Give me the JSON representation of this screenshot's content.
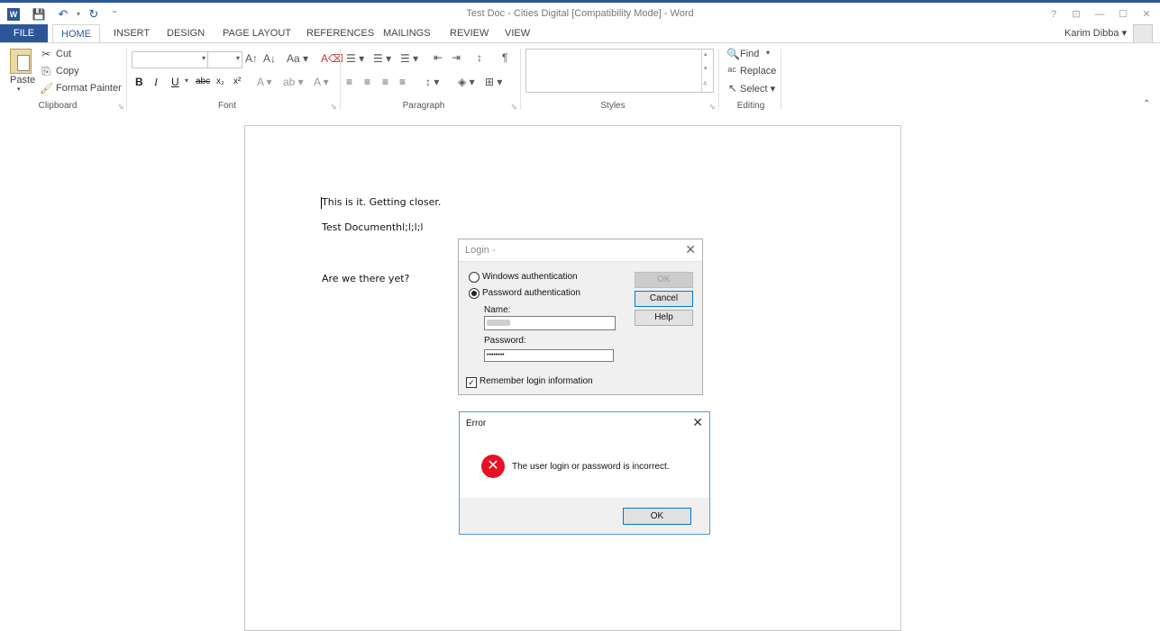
{
  "window": {
    "title": "Test Doc - Cities Digital [Compatibility Mode] - Word",
    "quick_access": {
      "word_icon": "W",
      "save": "💾",
      "undo": "↶",
      "redo": "↻",
      "customize": "⁼"
    },
    "controls": {
      "help": "?",
      "restore_ribbon": "⊡",
      "minimize": "—",
      "maximize": "☐",
      "close": "✕"
    }
  },
  "tabs": [
    "FILE",
    "HOME",
    "INSERT",
    "DESIGN",
    "PAGE LAYOUT",
    "REFERENCES",
    "MAILINGS",
    "REVIEW",
    "VIEW"
  ],
  "active_tab": "HOME",
  "user": {
    "name": "Karim Dibba ▾"
  },
  "ribbon": {
    "clipboard": {
      "label": "Clipboard",
      "paste": "Paste",
      "paste_arrow": "▾",
      "cut": "Cut",
      "copy": "Copy",
      "format_painter": "Format Painter"
    },
    "font": {
      "label": "Font",
      "font_name": "",
      "font_size": "",
      "grow": "A↑",
      "shrink": "A↓",
      "change_case": "Aa ▾",
      "clear": "A⌫",
      "bold": "B",
      "italic": "I",
      "underline": "U",
      "underline_arrow": "▾",
      "strike": "abc",
      "subscript": "x₂",
      "superscript": "x²",
      "text_effects": "A ▾",
      "highlight": "ab ▾",
      "font_color": "A ▾"
    },
    "paragraph": {
      "label": "Paragraph",
      "bullets": "☰ ▾",
      "numbering": "☰ ▾",
      "multilevel": "☰ ▾",
      "decrease_indent": "⇤",
      "increase_indent": "⇥",
      "sort": "↕",
      "pilcrow": "¶",
      "align_left": "≡",
      "center": "≡",
      "align_right": "≡",
      "justify": "≡",
      "line_spacing": "↕ ▾",
      "shading": "◈ ▾",
      "borders": "⊞ ▾"
    },
    "styles": {
      "label": "Styles"
    },
    "editing": {
      "label": "Editing",
      "find": "Find",
      "find_arrow": "▾",
      "replace": "Replace",
      "select": "Select ▾"
    },
    "collapse": "⌃"
  },
  "document": {
    "lines": [
      "This is it. Getting closer.",
      "Test Documenthl;l;l;l",
      "Are we there yet?"
    ]
  },
  "login_dialog": {
    "title": "Login -",
    "close": "✕",
    "windows_auth": "Windows authentication",
    "password_auth": "Password authentication",
    "name_label": "Name:",
    "name_value": "",
    "password_label": "Password:",
    "password_value": "••••••••",
    "ok": "OK",
    "cancel": "Cancel",
    "help": "Help",
    "remember": "Remember login information",
    "remember_checked": "✓"
  },
  "error_dialog": {
    "title": "Error",
    "close": "✕",
    "icon": "✕",
    "message": "The user login or password is incorrect.",
    "ok": "OK"
  },
  "colors": {
    "accent": "#2b579a",
    "error": "#e81123",
    "focus": "#0078d7"
  }
}
